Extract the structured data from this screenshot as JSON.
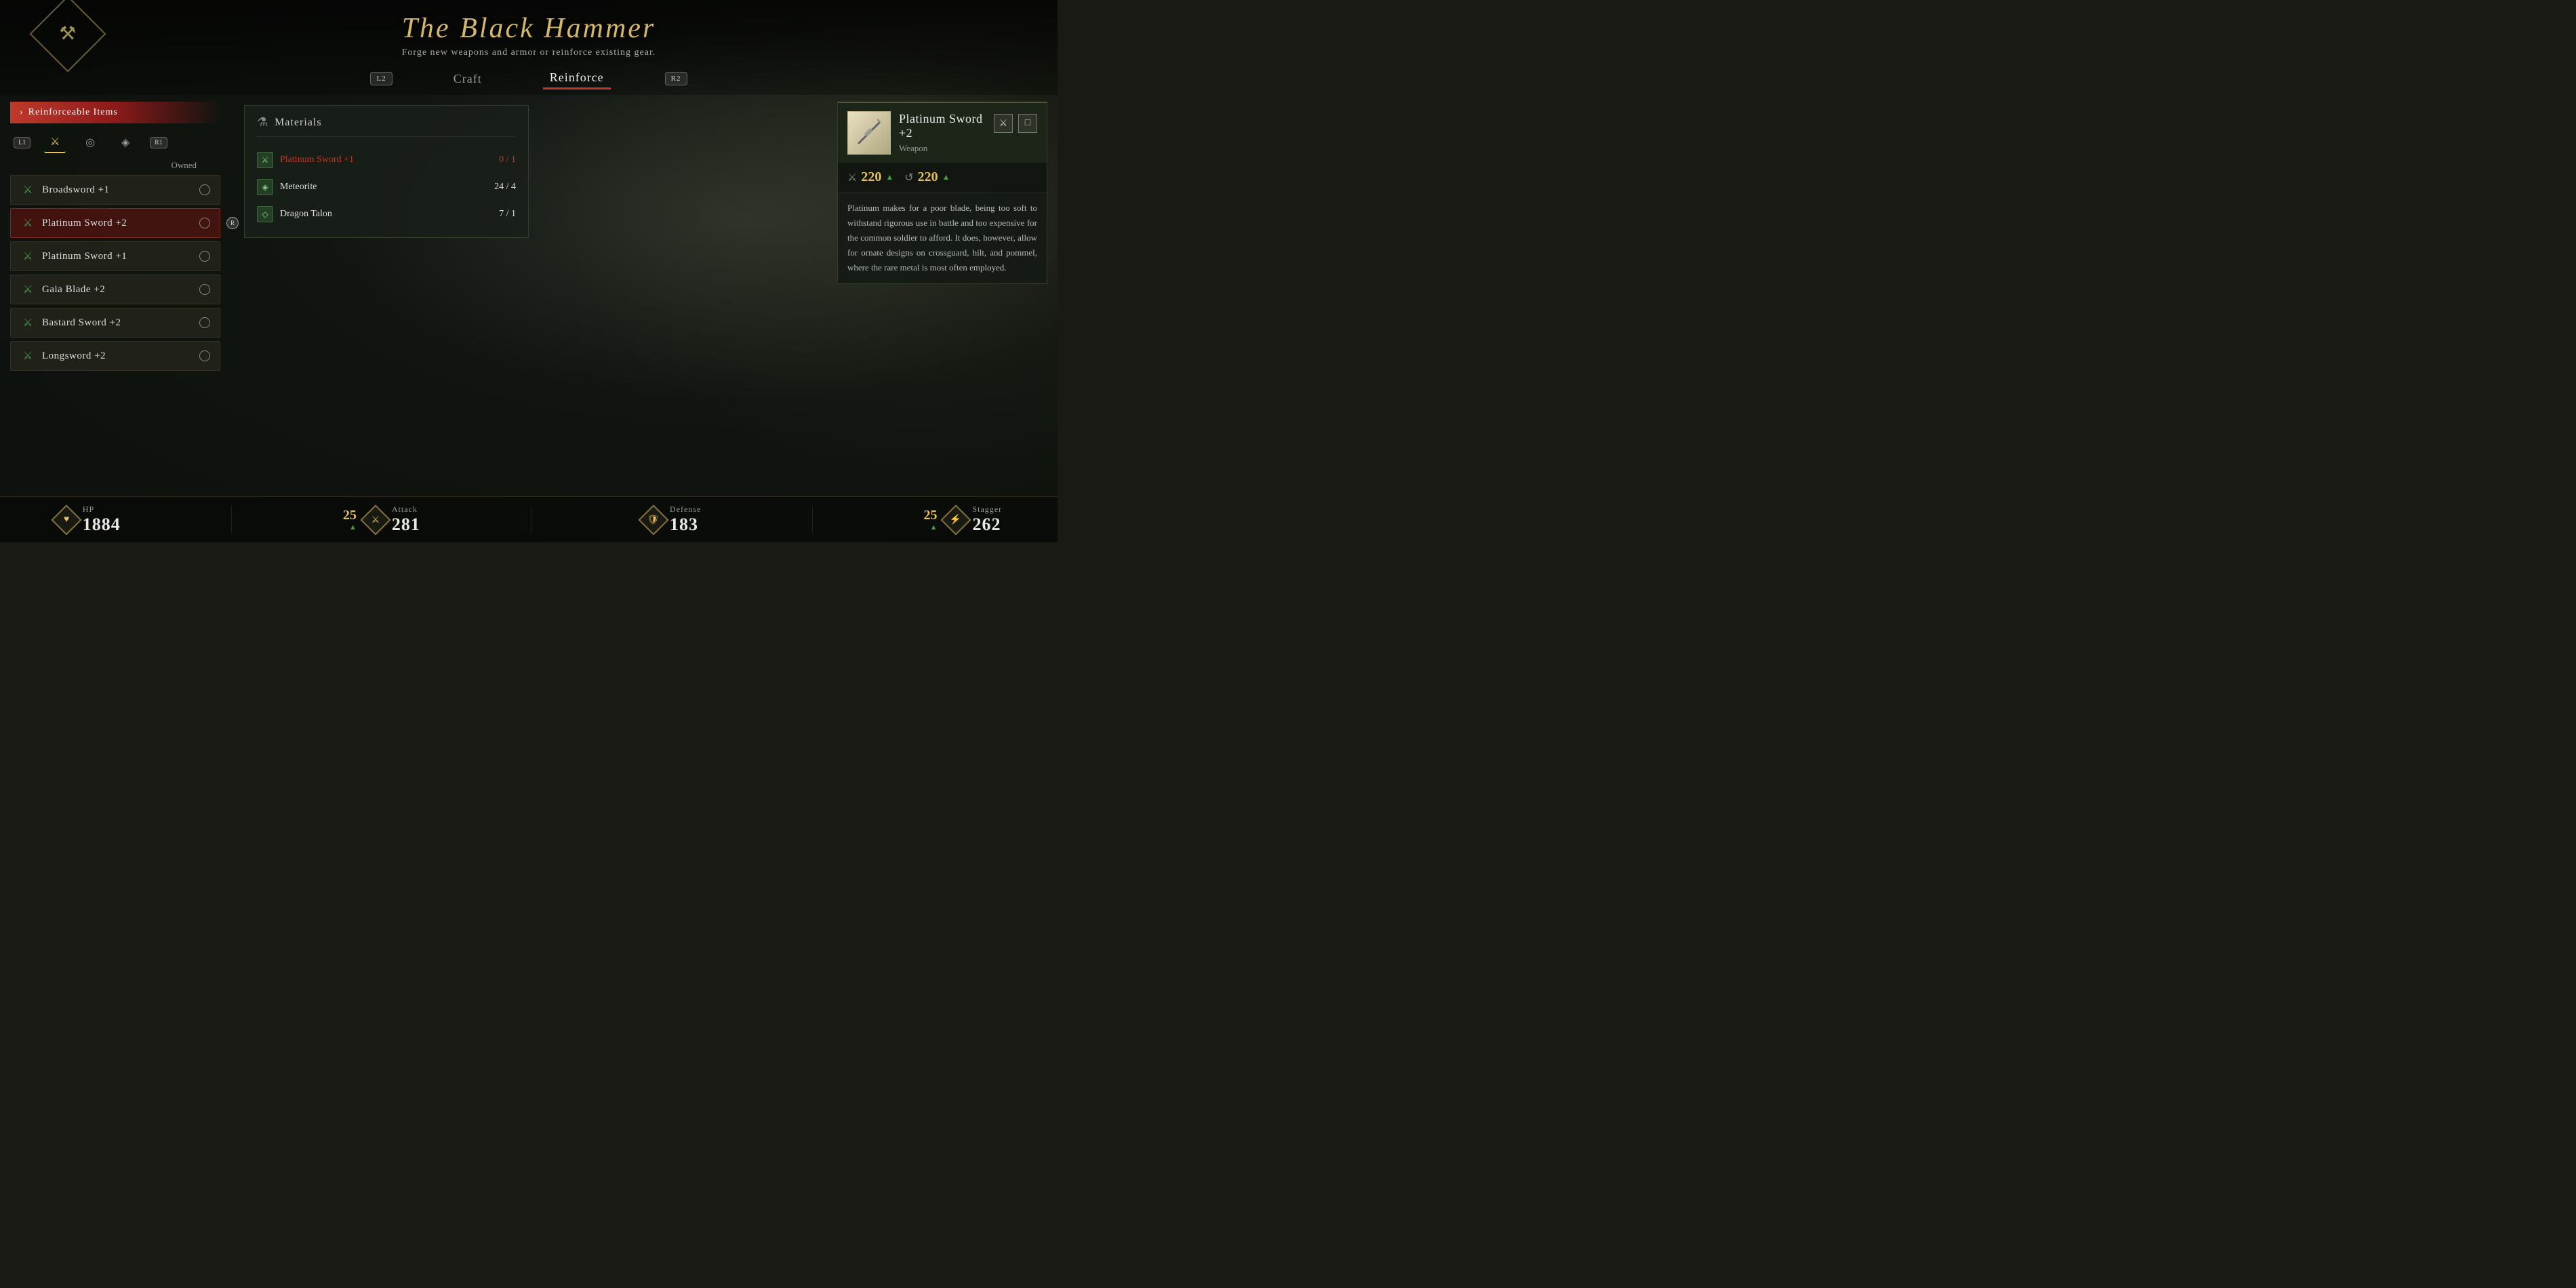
{
  "app": {
    "title": "The Black Hammer",
    "subtitle": "Forge new weapons and armor or reinforce existing gear."
  },
  "nav": {
    "left_button": "L2",
    "right_button": "R2",
    "tabs": [
      {
        "label": "Craft",
        "active": false
      },
      {
        "label": "Reinforce",
        "active": true
      }
    ]
  },
  "logo": {
    "icon": "⚒"
  },
  "left_panel": {
    "banner_text": "Reinforceable Items",
    "categories": [
      {
        "label": "L1",
        "type": "button"
      },
      {
        "label": "⚔",
        "type": "icon",
        "active": true
      },
      {
        "label": "◎",
        "type": "icon"
      },
      {
        "label": "◈",
        "type": "icon"
      },
      {
        "label": "R1",
        "type": "button"
      }
    ],
    "owned_label": "Owned",
    "items": [
      {
        "name": "Broadsword +1",
        "owned": false,
        "selected": false
      },
      {
        "name": "Platinum Sword +2",
        "owned": false,
        "selected": true
      },
      {
        "name": "Platinum Sword +1",
        "owned": false,
        "selected": false
      },
      {
        "name": "Gaia Blade +2",
        "owned": false,
        "selected": false
      },
      {
        "name": "Bastard Sword +2",
        "owned": false,
        "selected": false
      },
      {
        "name": "Longsword +2",
        "owned": false,
        "selected": false
      }
    ]
  },
  "center_panel": {
    "materials_title": "Materials",
    "materials": [
      {
        "name": "Platinum Sword +1",
        "current": 0,
        "required": 1,
        "missing": true
      },
      {
        "name": "Meteorite",
        "current": 24,
        "required": 4,
        "missing": false
      },
      {
        "name": "Dragon Talon",
        "current": 7,
        "required": 1,
        "missing": false
      }
    ]
  },
  "right_panel": {
    "item_name": "Platinum Sword +2",
    "item_type": "Weapon",
    "attack_value": "220",
    "magic_value": "220",
    "description": "Platinum makes for a poor blade, being too soft to withstand rigorous use in battle and too expensive for the common soldier to afford. It does, however, allow for ornate designs on crossguard, hilt, and pommel, where the rare metal is most often employed."
  },
  "status_bar": {
    "hp_label": "HP",
    "hp_value": "1884",
    "attack_label": "Attack",
    "attack_value": "281",
    "attack_bonus": "25",
    "defense_label": "Defense",
    "defense_value": "183",
    "stagger_label": "Stagger",
    "stagger_value": "262",
    "stagger_bonus": "25"
  }
}
